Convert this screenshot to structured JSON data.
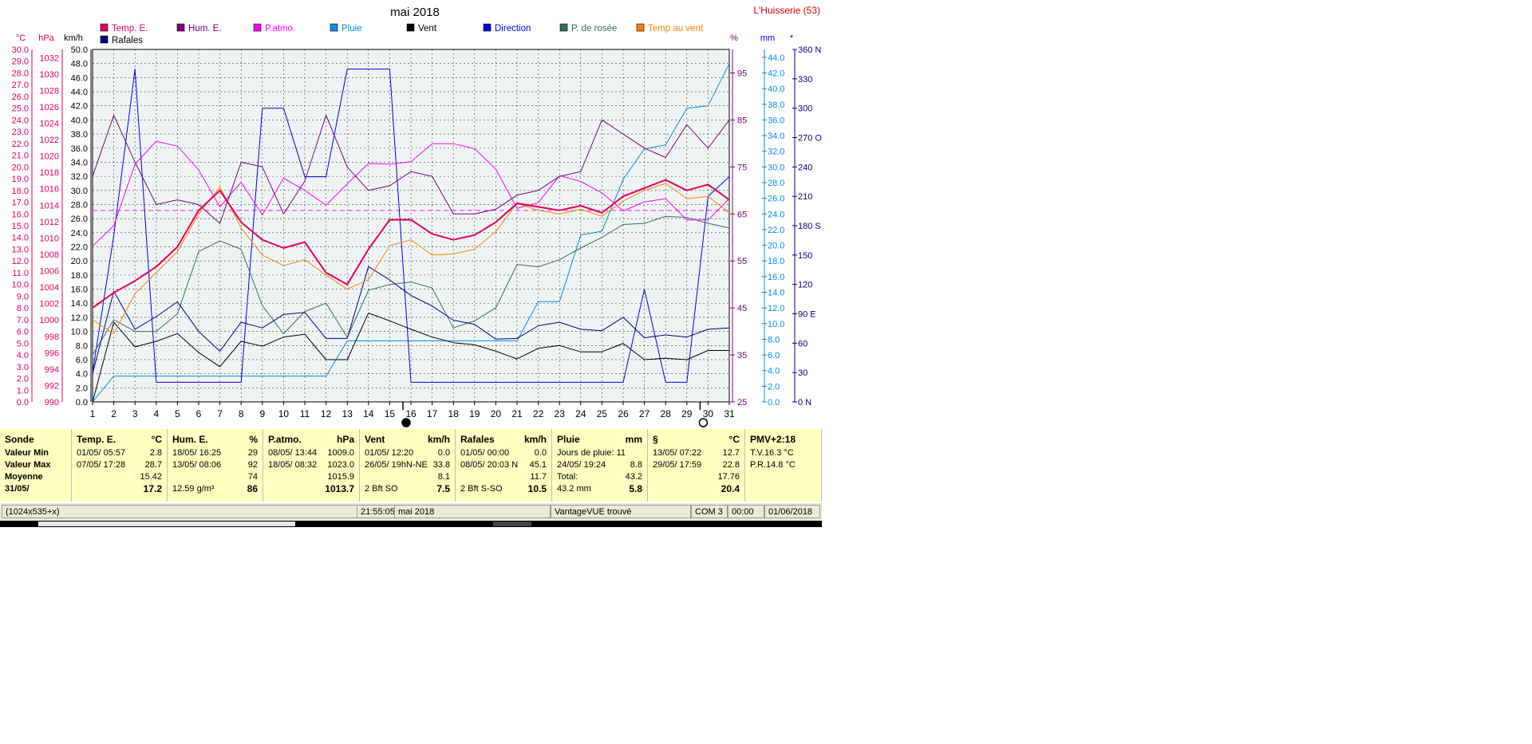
{
  "chart_data": {
    "type": "line",
    "title": "mai 2018",
    "station": "L'Huisserie (53)",
    "x": [
      1,
      2,
      3,
      4,
      5,
      6,
      7,
      8,
      9,
      10,
      11,
      12,
      13,
      14,
      15,
      16,
      17,
      18,
      19,
      20,
      21,
      22,
      23,
      24,
      25,
      26,
      27,
      28,
      29,
      30,
      31
    ],
    "x_ticks": [
      "1",
      "2",
      "3",
      "4",
      "5",
      "6",
      "7",
      "8",
      "9",
      "10",
      "11",
      "12",
      "13",
      "14",
      "15",
      "16",
      "17",
      "18",
      "19",
      "20",
      "21",
      "22",
      "23",
      "24",
      "25",
      "26",
      "27",
      "28",
      "29",
      "30",
      "31"
    ],
    "grid": true,
    "legend": "top",
    "axes": {
      "temp": {
        "label": "°C",
        "range": [
          0,
          30
        ],
        "ticks": [
          "0.0",
          "1.0",
          "2.0",
          "3.0",
          "4.0",
          "5.0",
          "6.0",
          "7.0",
          "8.0",
          "9.0",
          "10.0",
          "11.0",
          "12.0",
          "13.0",
          "14.0",
          "15.0",
          "16.0",
          "17.0",
          "18.0",
          "19.0",
          "20.0",
          "21.0",
          "22.0",
          "23.0",
          "24.0",
          "25.0",
          "26.0",
          "27.0",
          "28.0",
          "29.0",
          "30.0"
        ]
      },
      "pressure": {
        "label": "hPa",
        "range": [
          990,
          1033
        ],
        "ticks": [
          "990",
          "992",
          "994",
          "996",
          "998",
          "1000",
          "1002",
          "1004",
          "1006",
          "1008",
          "1010",
          "1012",
          "1014",
          "1016",
          "1018",
          "1020",
          "1022",
          "1024",
          "1026",
          "1028",
          "1030",
          "1032"
        ]
      },
      "wind": {
        "label": "km/h",
        "range": [
          0,
          50
        ],
        "ticks": [
          "0.0",
          "2.0",
          "4.0",
          "6.0",
          "8.0",
          "10.0",
          "12.0",
          "14.0",
          "16.0",
          "18.0",
          "20.0",
          "22.0",
          "24.0",
          "26.0",
          "28.0",
          "30.0",
          "32.0",
          "34.0",
          "36.0",
          "38.0",
          "40.0",
          "42.0",
          "44.0",
          "46.0",
          "48.0",
          "50.0"
        ]
      },
      "humidity": {
        "label": "%",
        "range": [
          25,
          100
        ],
        "ticks": [
          "25",
          "35",
          "45",
          "55",
          "65",
          "75",
          "85",
          "95"
        ]
      },
      "rain": {
        "label": "mm",
        "range": [
          0,
          45
        ],
        "ticks": [
          "0.0",
          "2.0",
          "4.0",
          "6.0",
          "8.0",
          "10.0",
          "12.0",
          "14.0",
          "16.0",
          "18.0",
          "20.0",
          "22.0",
          "24.0",
          "26.0",
          "28.0",
          "30.0",
          "32.0",
          "34.0",
          "36.0",
          "38.0",
          "40.0",
          "42.0",
          "44.0"
        ]
      },
      "direction": {
        "label": "*",
        "range": [
          0,
          360
        ],
        "ticks": [
          "0 N",
          "30",
          "60",
          "90 E",
          "120",
          "150",
          "180 S",
          "210",
          "240",
          "270 O",
          "300",
          "330",
          "360 N"
        ]
      }
    },
    "series": [
      {
        "name": "Temp. E.",
        "axis": "temp",
        "color": "#e4005c",
        "width": 2,
        "values": [
          8.0,
          9.3,
          10.3,
          11.5,
          13.2,
          16.3,
          18.0,
          15.3,
          13.8,
          13.1,
          13.6,
          11.0,
          10.0,
          13.0,
          15.5,
          15.5,
          14.3,
          13.8,
          14.2,
          15.3,
          16.9,
          16.6,
          16.3,
          16.7,
          16.1,
          17.5,
          18.2,
          18.9,
          18.0,
          18.5,
          17.2
        ]
      },
      {
        "name": "Temp au vent",
        "axis": "temp",
        "color": "#ff8000",
        "width": 1,
        "values": [
          7.0,
          5.8,
          9.2,
          11.0,
          12.8,
          16.0,
          18.3,
          14.8,
          12.5,
          11.6,
          12.1,
          10.8,
          9.6,
          10.4,
          13.3,
          13.8,
          12.5,
          12.6,
          13.0,
          14.5,
          16.9,
          16.3,
          16.0,
          16.4,
          15.8,
          17.1,
          18.0,
          18.6,
          17.3,
          17.5,
          16.1
        ]
      },
      {
        "name": "Hum. E.",
        "axis": "humidity",
        "color": "#800080",
        "width": 1,
        "values": [
          73,
          86,
          76,
          67,
          68,
          67,
          63,
          76,
          75,
          65,
          72,
          86,
          75,
          70,
          71,
          74,
          73,
          65,
          65,
          66,
          69,
          70,
          73,
          74,
          85,
          82,
          79,
          77,
          84,
          79,
          85
        ]
      },
      {
        "name": "P.atmo.",
        "axis": "pressure",
        "color": "#ff00ff",
        "width": 1,
        "values": [
          1009.0,
          1011.5,
          1019.0,
          1021.8,
          1021.2,
          1018.3,
          1013.8,
          1016.8,
          1012.8,
          1017.3,
          1015.8,
          1014.0,
          1016.6,
          1019.1,
          1019.0,
          1019.3,
          1021.5,
          1021.5,
          1020.9,
          1018.4,
          1013.6,
          1014.3,
          1017.6,
          1016.9,
          1015.5,
          1013.3,
          1014.4,
          1014.8,
          1012.2,
          1012.2,
          1014.8
        ]
      },
      {
        "name": "Pluie",
        "axis": "rain",
        "color": "#0090e0",
        "width": 1,
        "values": [
          0.0,
          3.3,
          3.3,
          3.3,
          3.3,
          3.3,
          3.3,
          3.3,
          3.3,
          3.3,
          3.3,
          3.3,
          7.8,
          7.8,
          7.8,
          7.8,
          7.8,
          7.8,
          7.8,
          7.8,
          7.8,
          12.8,
          12.8,
          21.3,
          21.8,
          28.4,
          32.3,
          32.8,
          37.5,
          37.8,
          43.2
        ]
      },
      {
        "name": "Vent",
        "axis": "wind",
        "color": "#000000",
        "width": 1,
        "values": [
          0.0,
          11.3,
          7.8,
          8.6,
          9.7,
          7.0,
          5.0,
          8.6,
          7.9,
          9.2,
          9.6,
          6.0,
          6.0,
          12.6,
          11.5,
          10.3,
          9.2,
          8.4,
          8.1,
          7.2,
          6.1,
          7.6,
          8.0,
          7.1,
          7.1,
          8.3,
          6.0,
          6.2,
          6.0,
          7.3,
          7.3
        ]
      },
      {
        "name": "Rafales",
        "axis": "wind",
        "color": "#000080",
        "width": 1,
        "values": [
          4.0,
          15.7,
          10.3,
          12.1,
          14.2,
          10.0,
          7.2,
          11.3,
          10.5,
          12.4,
          12.7,
          9.0,
          9.0,
          19.2,
          17.3,
          15.1,
          13.6,
          11.6,
          11.0,
          8.9,
          9.0,
          10.8,
          11.3,
          10.3,
          10.1,
          12.0,
          9.1,
          9.5,
          9.2,
          10.3,
          10.5
        ]
      },
      {
        "name": "Direction",
        "axis": "direction",
        "color": "#0000e0",
        "width": 1,
        "values": [
          30,
          170,
          340,
          20,
          20,
          20,
          20,
          20,
          300,
          300,
          230,
          230,
          340,
          340,
          340,
          20,
          20,
          20,
          20,
          20,
          20,
          20,
          20,
          20,
          20,
          20,
          115,
          20,
          20,
          210,
          230
        ]
      },
      {
        "name": "P. de rosée",
        "axis": "temp",
        "color": "#2f7060",
        "width": 1,
        "values": [
          4.0,
          7.0,
          6.0,
          6.0,
          7.5,
          12.8,
          13.7,
          13.0,
          8.2,
          5.8,
          7.7,
          8.4,
          5.5,
          9.5,
          10.0,
          10.2,
          9.7,
          6.3,
          6.9,
          8.0,
          11.7,
          11.5,
          12.1,
          13.1,
          14.0,
          15.1,
          15.2,
          15.8,
          15.7,
          15.2,
          14.8
        ]
      }
    ],
    "legend_entries": [
      "Temp. E.",
      "Hum. E.",
      "P.atmo.",
      "Pluie",
      "Vent",
      "Direction",
      "P. de rosée",
      "Temp au vent",
      "Rafales"
    ],
    "reference_line": {
      "axis": "temp",
      "value": 16.3,
      "color": "#ff40ff"
    },
    "moon_markers": [
      {
        "day": 16,
        "phase": "new"
      },
      {
        "day": 30,
        "phase": "full"
      }
    ]
  },
  "summary": {
    "columns": [
      {
        "title": "Sonde",
        "unit": "",
        "rows": [
          [
            "Valeur Min",
            ""
          ],
          [
            "Valeur Max",
            ""
          ],
          [
            "Moyenne",
            ""
          ],
          [
            "31/05/",
            ""
          ]
        ]
      },
      {
        "title": "Temp. E.",
        "unit": "°C",
        "rows": [
          [
            "01/05/  05:57",
            "2.8"
          ],
          [
            "07/05/  17:28",
            "28.7"
          ],
          [
            "",
            "15.42"
          ],
          [
            "",
            "17.2"
          ]
        ]
      },
      {
        "title": "Hum. E.",
        "unit": "%",
        "rows": [
          [
            "18/05/  16:25",
            "29"
          ],
          [
            "13/05/  08:06",
            "92"
          ],
          [
            "",
            "74"
          ],
          [
            "12.59 g/m³",
            "86"
          ]
        ]
      },
      {
        "title": "P.atmo.",
        "unit": "hPa",
        "rows": [
          [
            "08/05/  13:44",
            "1009.0"
          ],
          [
            "18/05/  08:32",
            "1023.0"
          ],
          [
            "",
            "1015.9"
          ],
          [
            "",
            "1013.7"
          ]
        ]
      },
      {
        "title": "Vent",
        "unit": "km/h",
        "rows": [
          [
            "01/05/  12:20",
            "0.0"
          ],
          [
            "26/05/  19hN-NE",
            "33.8"
          ],
          [
            "",
            "8.1"
          ],
          [
            "2 Bft SO",
            "7.5"
          ]
        ]
      },
      {
        "title": "Rafales",
        "unit": "km/h",
        "rows": [
          [
            "01/05/  00:00",
            "0.0"
          ],
          [
            "08/05/  20:03  N",
            "45.1"
          ],
          [
            "",
            "11.7"
          ],
          [
            "2 Bft S-SO",
            "10.5"
          ]
        ]
      },
      {
        "title": "Pluie",
        "unit": "mm",
        "rows": [
          [
            "Jours de pluie: 11",
            ""
          ],
          [
            "24/05/  19:24",
            "8.8"
          ],
          [
            "Total:",
            "43.2"
          ],
          [
            "43.2 mm",
            "5.8"
          ]
        ]
      },
      {
        "title": "§",
        "unit": "°C",
        "rows": [
          [
            "13/05/  07:22",
            "12.7"
          ],
          [
            "29/05/  17:59",
            "22.8"
          ],
          [
            "",
            "17.76"
          ],
          [
            "",
            "20.4"
          ]
        ]
      },
      {
        "title": "PMV+2:18",
        "unit": "",
        "rows": [
          [
            "T.V.16.3 °C",
            ""
          ],
          [
            "P.R.14.8 °C",
            ""
          ],
          [
            "",
            ""
          ],
          [
            "",
            ""
          ]
        ]
      }
    ]
  },
  "status_bar": {
    "size": "(1024x535+x)",
    "time": "21:55:05",
    "period": "mai 2018",
    "station": "VantageVUE trouvé",
    "port": "COM 3",
    "hour": "00:00",
    "date": "01/06/2018"
  }
}
